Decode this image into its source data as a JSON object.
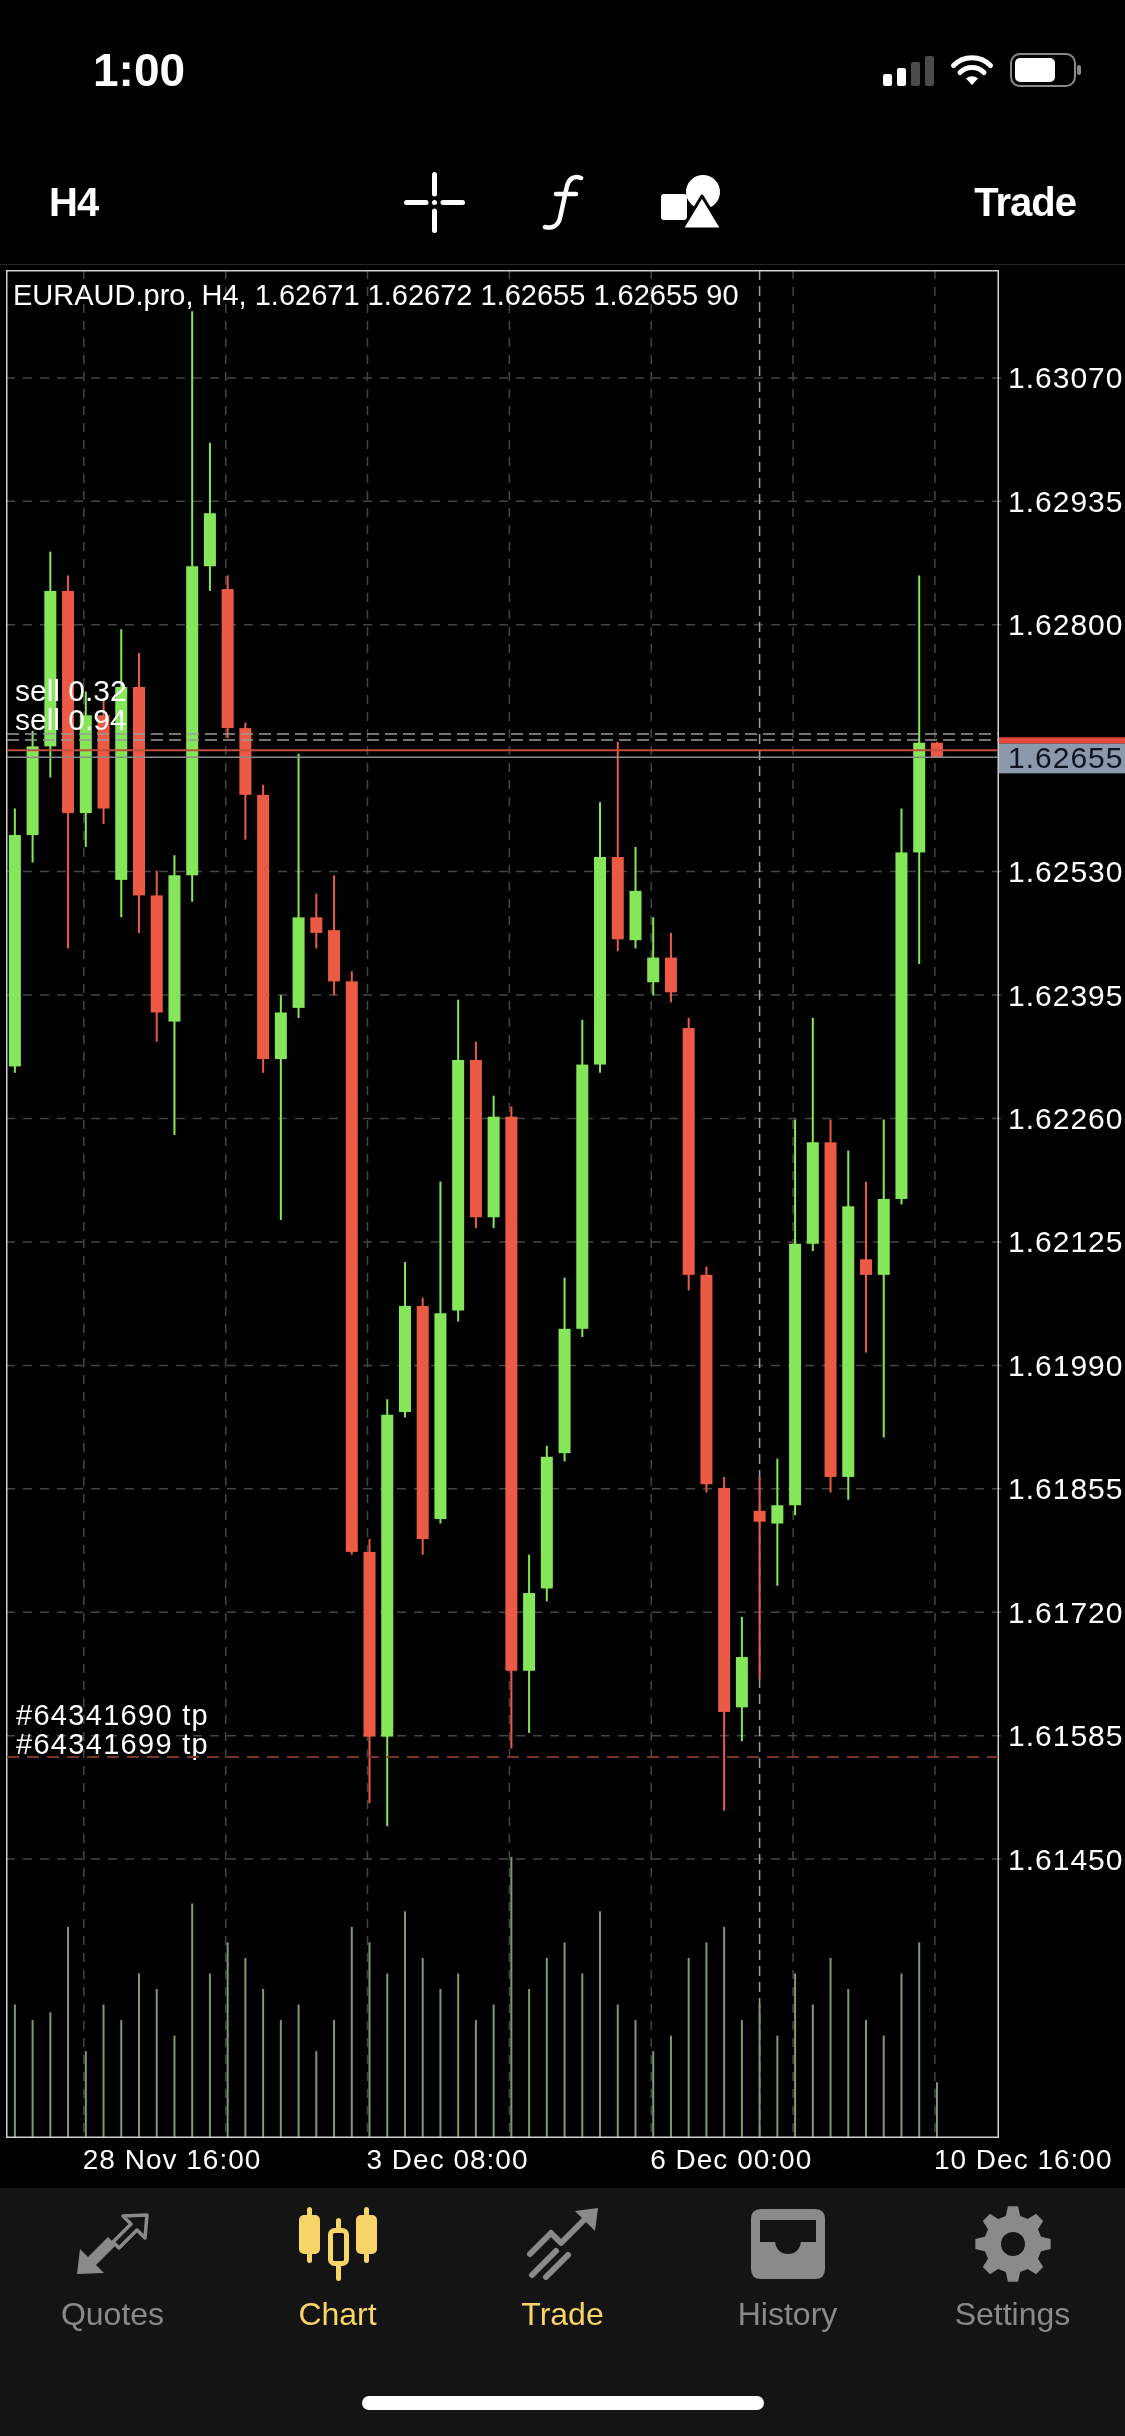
{
  "status_bar": {
    "time": "1:00"
  },
  "toolbar": {
    "timeframe": "H4",
    "trade_button": "Trade"
  },
  "chart": {
    "header": "EURAUD.pro, H4, 1.62671 1.62672 1.62655 1.62655 90",
    "current_price": "1.62655",
    "order_labels": [
      "sell 0.32",
      "sell 0.94"
    ],
    "tp_labels": [
      "#64341690 tp",
      "#64341699 tp"
    ],
    "chart_data": {
      "type": "candlestick",
      "grid": true,
      "categories": [
        null,
        null,
        null,
        null,
        null,
        null,
        null,
        null,
        null,
        null,
        null,
        null,
        null,
        null,
        null,
        null,
        null,
        null,
        null,
        null,
        null,
        null,
        null,
        null,
        null,
        null,
        null,
        null,
        null,
        null,
        null,
        null,
        null,
        null,
        null,
        null,
        null,
        null,
        null,
        null,
        null,
        null,
        null,
        null,
        null,
        null,
        null,
        null,
        null,
        null,
        null,
        null,
        null,
        null,
        null,
        null
      ],
      "ohlc": [
        [
          1.62317,
          1.62599,
          1.6231,
          1.6257
        ],
        [
          1.6257,
          1.62684,
          1.6254,
          1.62667
        ],
        [
          1.62667,
          1.6288,
          1.62633,
          1.62837
        ],
        [
          1.62837,
          1.62854,
          1.62446,
          1.62594
        ],
        [
          1.62594,
          1.62727,
          1.62557,
          1.62701
        ],
        [
          1.62701,
          1.62718,
          1.62582,
          1.62599
        ],
        [
          1.62521,
          1.62795,
          1.6248,
          1.62732
        ],
        [
          1.62732,
          1.62769,
          1.62463,
          1.62504
        ],
        [
          1.62504,
          1.62531,
          1.62344,
          1.62376
        ],
        [
          1.62366,
          1.62548,
          1.62242,
          1.62526
        ],
        [
          1.62526,
          1.63143,
          1.62497,
          1.62864
        ],
        [
          1.62864,
          1.62999,
          1.62837,
          1.62922
        ],
        [
          1.62839,
          1.62854,
          1.62676,
          1.62687
        ],
        [
          1.62687,
          1.62693,
          1.62565,
          1.62614
        ],
        [
          1.62614,
          1.62625,
          1.6231,
          1.62325
        ],
        [
          1.62325,
          1.62395,
          1.62149,
          1.62376
        ],
        [
          1.62381,
          1.62659,
          1.6237,
          1.6248
        ],
        [
          1.6248,
          1.62506,
          1.62446,
          1.62463
        ],
        [
          1.62466,
          1.62526,
          1.62395,
          1.6241
        ],
        [
          1.6241,
          1.62421,
          1.61783,
          1.61786
        ],
        [
          1.61786,
          1.618,
          1.61511,
          1.61584
        ],
        [
          1.61584,
          1.61953,
          1.61486,
          1.61936
        ],
        [
          1.61939,
          1.62103,
          1.61933,
          1.62055
        ],
        [
          1.62055,
          1.62064,
          1.61783,
          1.618
        ],
        [
          1.61822,
          1.62191,
          1.61817,
          1.62047
        ],
        [
          1.6205,
          1.6239,
          1.62038,
          1.62324
        ],
        [
          1.62324,
          1.62344,
          1.6214,
          1.62152
        ],
        [
          1.62152,
          1.62285,
          1.6214,
          1.62262
        ],
        [
          1.62262,
          1.62273,
          1.61571,
          1.61656
        ],
        [
          1.61656,
          1.61783,
          1.61588,
          1.61741
        ],
        [
          1.61746,
          1.61902,
          1.61732,
          1.6189
        ],
        [
          1.61894,
          1.62086,
          1.61885,
          1.6203
        ],
        [
          1.6203,
          1.62368,
          1.62021,
          1.62319
        ],
        [
          1.62319,
          1.62606,
          1.6231,
          1.62546
        ],
        [
          1.62546,
          1.62672,
          1.62443,
          1.62456
        ],
        [
          1.62455,
          1.62557,
          1.62446,
          1.62509
        ],
        [
          1.62409,
          1.6248,
          1.62395,
          1.62436
        ],
        [
          1.62436,
          1.62463,
          1.62387,
          1.62398
        ],
        [
          1.62359,
          1.6237,
          1.62072,
          1.62089
        ],
        [
          1.62089,
          1.62098,
          1.61851,
          1.6186
        ],
        [
          1.61856,
          1.61868,
          1.61503,
          1.61611
        ],
        [
          1.61616,
          1.61715,
          1.61579,
          1.61671
        ],
        [
          1.61831,
          1.61868,
          1.61647,
          1.61819
        ],
        [
          1.61817,
          1.61888,
          1.61749,
          1.61837
        ],
        [
          1.61837,
          1.62259,
          1.61826,
          1.62123
        ],
        [
          1.62123,
          1.6237,
          1.62115,
          1.62234
        ],
        [
          1.62234,
          1.62259,
          1.61851,
          1.61868
        ],
        [
          1.61868,
          1.62225,
          1.61843,
          1.62164
        ],
        [
          1.62106,
          1.62191,
          1.62004,
          1.62089
        ],
        [
          1.62089,
          1.62259,
          1.61911,
          1.62172
        ],
        [
          1.62172,
          1.62599,
          1.62166,
          1.62551
        ],
        [
          1.62551,
          1.62854,
          1.62429,
          1.62671
        ],
        [
          1.62671,
          1.62672,
          1.62655,
          1.62655
        ],
        null,
        null,
        null
      ],
      "ylim": [
        1.61145,
        1.63188
      ],
      "yticks": [
        {
          "value": 1.6307,
          "label": "1.63070"
        },
        {
          "value": 1.62935,
          "label": "1.62935"
        },
        {
          "value": 1.628,
          "label": "1.62800"
        },
        {
          "value": 1.6253,
          "label": "1.62530"
        },
        {
          "value": 1.62395,
          "label": "1.62395"
        },
        {
          "value": 1.6226,
          "label": "1.62260"
        },
        {
          "value": 1.62125,
          "label": "1.62125"
        },
        {
          "value": 1.6199,
          "label": "1.61990"
        },
        {
          "value": 1.61855,
          "label": "1.61855"
        },
        {
          "value": 1.6172,
          "label": "1.61720"
        },
        {
          "value": 1.61585,
          "label": "1.61585"
        },
        {
          "value": 1.6145,
          "label": "1.61450"
        }
      ]
    },
    "time_labels": [
      "28 Nov 16:00",
      "3 Dec 08:00",
      "6 Dec 00:00",
      "10 Dec 16:00"
    ]
  },
  "tab_bar": {
    "tabs": [
      {
        "label": "Quotes",
        "selected": false,
        "highlighted": false
      },
      {
        "label": "Chart",
        "selected": true,
        "highlighted": true
      },
      {
        "label": "Trade",
        "selected": false,
        "highlighted": true
      },
      {
        "label": "History",
        "selected": false,
        "highlighted": false
      },
      {
        "label": "Settings",
        "selected": false,
        "highlighted": false
      }
    ]
  }
}
